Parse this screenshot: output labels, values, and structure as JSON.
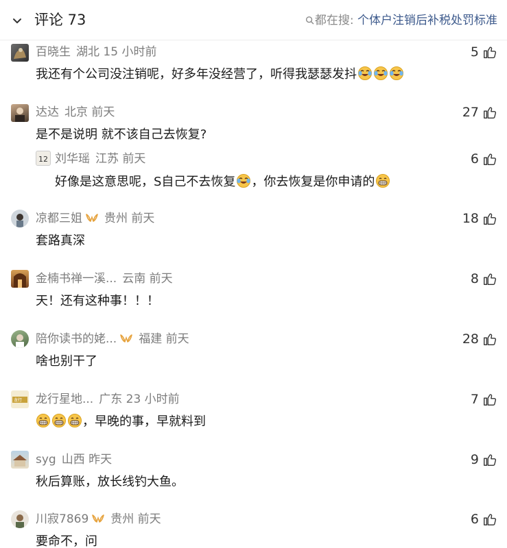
{
  "header": {
    "title": "评论 73",
    "search_label": "都在搜:",
    "search_query": "个体户注销后补税处罚标准"
  },
  "comments": [
    {
      "user": "百晓生",
      "location": "湖北",
      "time": "15 小时前",
      "likes": "5",
      "text": "我还有个公司没注销呢，好多年没经营了，听得我瑟瑟发抖"
    },
    {
      "user": "达达",
      "location": "北京",
      "time": "前天",
      "likes": "27",
      "text": "是不是说明 就不该自己去恢复?"
    },
    {
      "user": "刘华瑶",
      "location": "江苏",
      "time": "前天",
      "likes": "6",
      "text_a": "好像是这意思呢，S自己不去恢复",
      "text_b": "，你去恢复是你申请的"
    },
    {
      "user": "凉都三姐",
      "location": "贵州",
      "time": "前天",
      "likes": "18",
      "text": "套路真深"
    },
    {
      "user": "金楠书禅一溪...",
      "location": "云南",
      "time": "前天",
      "likes": "8",
      "text": "天！还有这种事！！！"
    },
    {
      "user": "陪你读书的姥...",
      "location": "福建",
      "time": "前天",
      "likes": "28",
      "text": "啥也别干了"
    },
    {
      "user": "龙行星地...",
      "location": "广东",
      "time": "23 小时前",
      "likes": "7",
      "text": "，早晚的事，早就料到"
    },
    {
      "user": "syg",
      "location": "山西",
      "time": "昨天",
      "likes": "9",
      "text": "秋后算账，放长线钓大鱼。"
    },
    {
      "user": "川寂7869",
      "location": "贵州",
      "time": "前天",
      "likes": "6",
      "text": "要命不，问"
    }
  ],
  "icons": {
    "collapse": "chevron-down-icon",
    "search": "search-icon",
    "like": "thumbs-up-icon",
    "badge": "vip-badge-icon",
    "cry_laugh": "tears-of-joy-emoji",
    "grin": "grinning-emoji"
  },
  "colors": {
    "link_blue": "#3d5a8c",
    "meta_gray": "#7c7c7c",
    "badge_gold": "#e6a23c",
    "emoji_yellow": "#f7c54a"
  }
}
